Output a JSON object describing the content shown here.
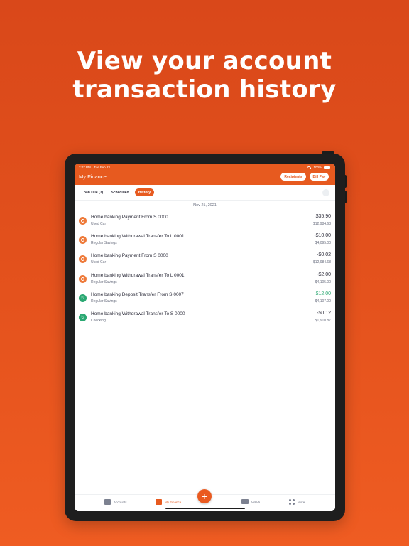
{
  "headline": {
    "line1": "View your account",
    "line2": "transaction history"
  },
  "status_bar": {
    "time": "2:07 PM",
    "date": "Tue Feb 23",
    "battery": "100%"
  },
  "header": {
    "title": "My Finance",
    "recipients_label": "Recipients",
    "billpay_label": "Bill Pay",
    "accent": "#e75a1f"
  },
  "tabs": [
    {
      "label": "Loan Due (3)",
      "active": false
    },
    {
      "label": "Scheduled",
      "active": false
    },
    {
      "label": "History",
      "active": true
    }
  ],
  "history": {
    "date": "Nov 21, 2021",
    "transactions": [
      {
        "description": "Home banking Payment From S 0000",
        "account": "Used Car",
        "amount": "$35.90",
        "balance": "$12,984.68",
        "icon": "person-icon",
        "positive": false
      },
      {
        "description": "Home banking Withdrawal Transfer To L 0001",
        "account": "Regular Savings",
        "amount": "-$10.00",
        "balance": "$4,095.00",
        "icon": "person-icon",
        "positive": false
      },
      {
        "description": "Home banking Payment From S 0000",
        "account": "Used Car",
        "amount": "-$0.02",
        "balance": "$12,984.68",
        "icon": "person-icon",
        "positive": false
      },
      {
        "description": "Home banking Withdrawal Transfer To L 0001",
        "account": "Regular Savings",
        "amount": "-$2.00",
        "balance": "$4,105.00",
        "icon": "person-icon",
        "positive": false
      },
      {
        "description": "Home banking Deposit Transfer From S 0007",
        "account": "Regular Savings",
        "amount": "$12.00",
        "balance": "$4,107.00",
        "icon": "transfer-icon",
        "positive": true
      },
      {
        "description": "Home banking Withdrawal Transfer To S 0000",
        "account": "Checking",
        "amount": "-$0.12",
        "balance": "$1,910.87",
        "icon": "transfer-icon",
        "positive": false
      }
    ]
  },
  "bottom_nav": {
    "accounts": "Accounts",
    "my_finance": "My Finance",
    "cards": "Cards",
    "more": "More",
    "fab": "+"
  }
}
